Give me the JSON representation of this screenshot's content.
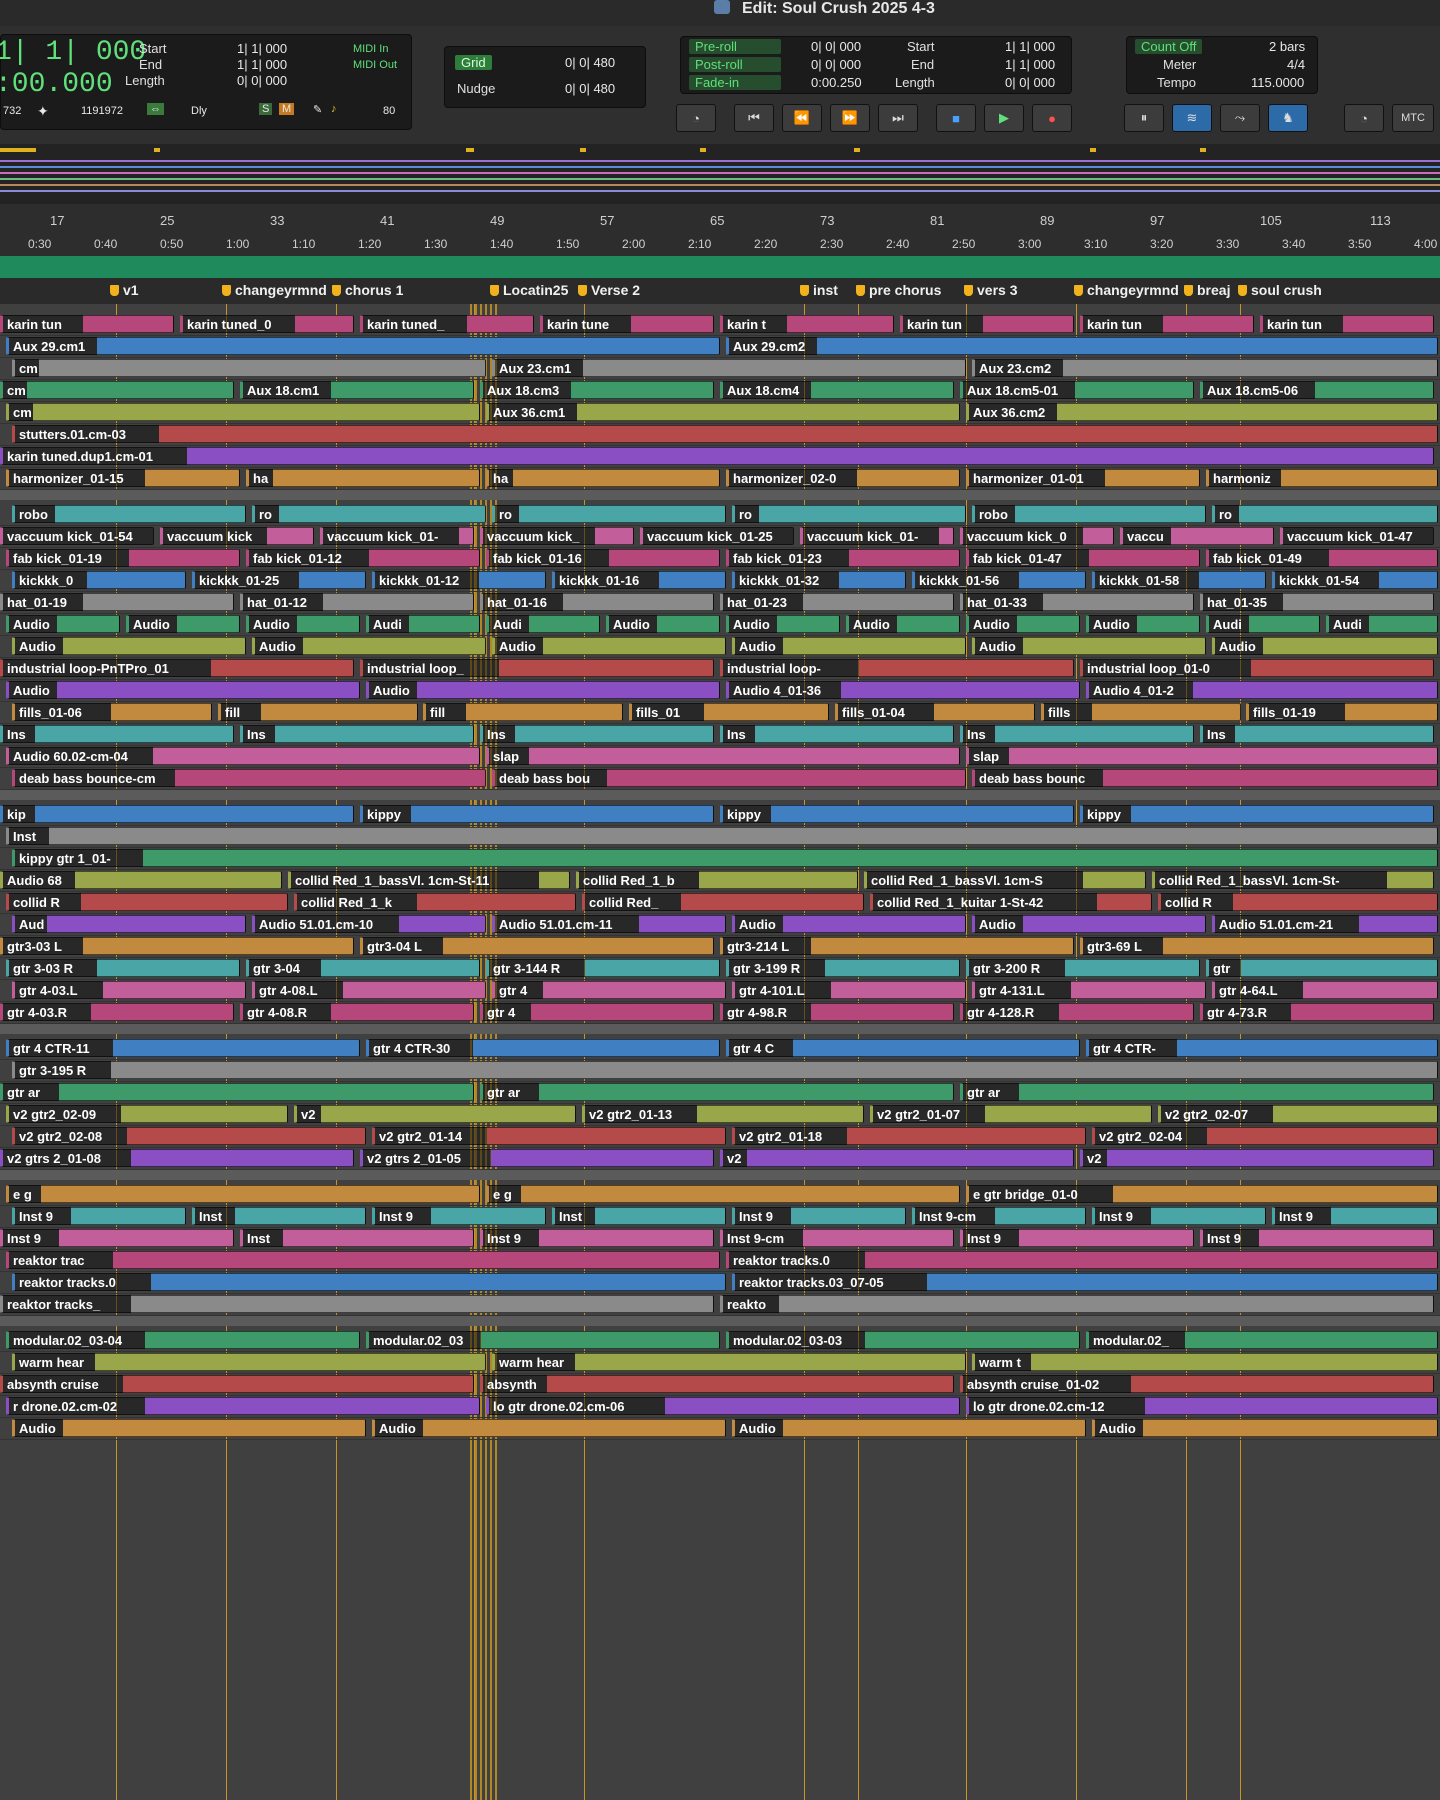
{
  "window": {
    "title": "Edit: Soul Crush 2025 4-3"
  },
  "counters": {
    "main_bars": "1| 1| 000",
    "main_time": ":00.000",
    "start_label": "Start",
    "end_label": "End",
    "length_label": "Length",
    "start": "1| 1| 000",
    "end": "1| 1| 000",
    "length": "0| 0| 000",
    "midi_in": "MIDI In",
    "midi_out": "MIDI Out",
    "sample_a": "732",
    "sample_b": "1191972",
    "dly": "Dly",
    "s": "S",
    "m": "M",
    "value80": "80"
  },
  "grid": {
    "grid_label": "Grid",
    "grid_value": "0| 0| 480",
    "nudge_label": "Nudge",
    "nudge_value": "0| 0| 480"
  },
  "preroll": {
    "pre_label": "Pre-roll",
    "pre_value": "0| 0| 000",
    "post_label": "Post-roll",
    "post_value": "0| 0| 000",
    "fade_label": "Fade-in",
    "fade_value": "0:00.250",
    "start_label": "Start",
    "start_value": "1| 1| 000",
    "end_label": "End",
    "end_value": "1| 1| 000",
    "length_label": "Length",
    "length_value": "0| 0| 000"
  },
  "countoff": {
    "count_label": "Count Off",
    "count_value": "2 bars",
    "meter_label": "Meter",
    "meter_value": "4/4",
    "tempo_label": "Tempo",
    "tempo_value": "115.0000"
  },
  "mtc": "MTC",
  "ruler": {
    "bars": [
      "17",
      "25",
      "33",
      "41",
      "49",
      "57",
      "65",
      "73",
      "81",
      "89",
      "97",
      "105",
      "113"
    ],
    "times": [
      "0:30",
      "0:40",
      "0:50",
      "1:00",
      "1:10",
      "1:20",
      "1:30",
      "1:40",
      "1:50",
      "2:00",
      "2:10",
      "2:20",
      "2:30",
      "2:40",
      "2:50",
      "3:00",
      "3:10",
      "3:20",
      "3:30",
      "3:40",
      "3:50",
      "4:00"
    ]
  },
  "markers": [
    "v1",
    "changeyrmnd",
    "chorus 1",
    "Locatin25",
    "Verse 2",
    "inst",
    "pre chorus",
    "vers 3",
    "changeyrmnd",
    "breaj",
    "soul crush"
  ],
  "clips": [
    [
      "karin tun",
      "karin tuned_0",
      "karin tuned_",
      "karin tune",
      "karin t",
      "karin tun",
      "karin tun",
      "karin tun"
    ],
    [
      "Aux 29.cm1",
      "Aux 29.cm2"
    ],
    [
      "cm",
      "Aux 23.cm1",
      "Aux 23.cm2"
    ],
    [
      "cm",
      "Aux 18.cm1",
      "Aux 18.cm3",
      "Aux 18.cm4",
      "Aux 18.cm5-01",
      "Aux 18.cm5-06"
    ],
    [
      "cm",
      "Aux 36.cm1",
      "Aux 36.cm2"
    ],
    [
      "stutters.01.cm-03"
    ],
    [
      "karin tuned.dup1.cm-01"
    ],
    [
      "harmonizer_01-15",
      "ha",
      "ha",
      "harmonizer_02-0",
      "harmonizer_01-01",
      "harmoniz"
    ],
    [
      "robo",
      "ro",
      "ro",
      "ro",
      "robo",
      "ro"
    ],
    [
      "vaccuum kick_01-54",
      "vaccuum kick",
      "vaccuum kick_01-",
      "vaccuum kick_",
      "vaccuum kick_01-25",
      "vaccuum kick_01-",
      "vaccuum kick_0",
      "vaccu",
      "vaccuum kick_01-47"
    ],
    [
      "fab kick_01-19",
      "fab kick_01-12",
      "fab kick_01-16",
      "fab kick_01-23",
      "fab kick_01-47",
      "fab kick_01-49"
    ],
    [
      "kickkk_0",
      "kickkk_01-25",
      "kickkk_01-12",
      "kickkk_01-16",
      "kickkk_01-32",
      "kickkk_01-56",
      "kickkk_01-58",
      "kickkk_01-54"
    ],
    [
      "hat_01-19",
      "hat_01-12",
      "hat_01-16",
      "hat_01-23",
      "hat_01-33",
      "hat_01-35"
    ],
    [
      "Audio",
      "Audio",
      "Audio",
      "Audi",
      "Audi",
      "Audio",
      "Audio",
      "Audio",
      "Audio",
      "Audio",
      "Audi",
      "Audi"
    ],
    [
      "Audio",
      "Audio",
      "Audio",
      "Audio",
      "Audio",
      "Audio"
    ],
    [
      "industrial loop-PnTPro_01",
      "industrial loop_",
      "industrial loop-",
      "industrial loop_01-0"
    ],
    [
      "Audio",
      "Audio",
      "Audio 4_01-36",
      "Audio 4_01-2"
    ],
    [
      "fills_01-06",
      "fill",
      "fill",
      "fills_01",
      "fills_01-04",
      "fills",
      "fills_01-19"
    ],
    [
      "Ins",
      "Ins",
      "Ins",
      "Ins",
      "Ins",
      "Ins"
    ],
    [
      "Audio 60.02-cm-04",
      "slap",
      "slap"
    ],
    [
      "deab bass bounce-cm",
      "deab bass bou",
      "deab bass bounc"
    ],
    [
      "kip",
      "kippy",
      "kippy",
      "kippy"
    ],
    [
      "Inst"
    ],
    [
      "kippy gtr 1_01-"
    ],
    [
      "Audio 68",
      "collid Red_1_bassVl. 1cm-St-11",
      "collid Red_1_b",
      "collid Red_1_bassVl. 1cm-S",
      "collid Red_1_bassVl. 1cm-St-"
    ],
    [
      "collid R",
      "collid Red_1_k",
      "collid Red_",
      "collid Red_1_kuitar 1-St-42",
      "collid R"
    ],
    [
      "Aud",
      "Audio 51.01.cm-10",
      "Audio 51.01.cm-11",
      "Audio",
      "Audio",
      "Audio 51.01.cm-21"
    ],
    [
      "gtr3-03 L",
      "gtr3-04 L",
      "gtr3-214 L",
      "gtr3-69 L"
    ],
    [
      "gtr 3-03 R",
      "gtr 3-04",
      "gtr 3-144 R",
      "gtr 3-199 R",
      "gtr 3-200 R",
      "gtr"
    ],
    [
      "gtr 4-03.L",
      "gtr 4-08.L",
      "gtr 4",
      "gtr 4-101.L",
      "gtr 4-131.L",
      "gtr 4-64.L"
    ],
    [
      "gtr 4-03.R",
      "gtr 4-08.R",
      "gtr 4",
      "gtr 4-98.R",
      "gtr 4-128.R",
      "gtr 4-73.R"
    ],
    [
      "gtr 4 CTR-11",
      "gtr 4 CTR-30",
      "gtr 4 C",
      "gtr 4 CTR-"
    ],
    [
      "gtr 3-195 R"
    ],
    [
      "gtr ar",
      "gtr ar",
      "gtr ar"
    ],
    [
      "v2 gtr2_02-09",
      "v2",
      "v2 gtr2_01-13",
      "v2 gtr2_01-07",
      "v2 gtr2_02-07"
    ],
    [
      "v2 gtr2_02-08",
      "v2 gtr2_01-14",
      "v2 gtr2_01-18",
      "v2 gtr2_02-04"
    ],
    [
      "v2 gtrs 2_01-08",
      "v2 gtrs 2_01-05",
      "v2",
      "v2"
    ],
    [
      "e g",
      "e g",
      "e gtr bridge_01-0"
    ],
    [
      "Inst 9",
      "Inst",
      "Inst 9",
      "Inst",
      "Inst 9",
      "Inst 9-cm",
      "Inst 9",
      "Inst 9"
    ],
    [
      "Inst 9",
      "Inst",
      "Inst 9",
      "Inst 9-cm",
      "Inst 9",
      "Inst 9"
    ],
    [
      "reaktor trac",
      "reaktor tracks.0"
    ],
    [
      "reaktor tracks.0",
      "reaktor tracks.03_07-05"
    ],
    [
      "reaktor tracks_",
      "reakto"
    ],
    [
      "modular.02_03-04",
      "modular.02_03",
      "modular.02_03-03",
      "modular.02_"
    ],
    [
      "warm hear",
      "warm hear",
      "warm t"
    ],
    [
      "absynth cruise",
      "absynth",
      "absynth cruise_01-02"
    ],
    [
      "r drone.02.cm-02",
      "lo gtr drone.02.cm-06",
      "lo gtr drone.02.cm-12"
    ],
    [
      "Audio",
      "Audio",
      "Audio",
      "Audio"
    ]
  ]
}
